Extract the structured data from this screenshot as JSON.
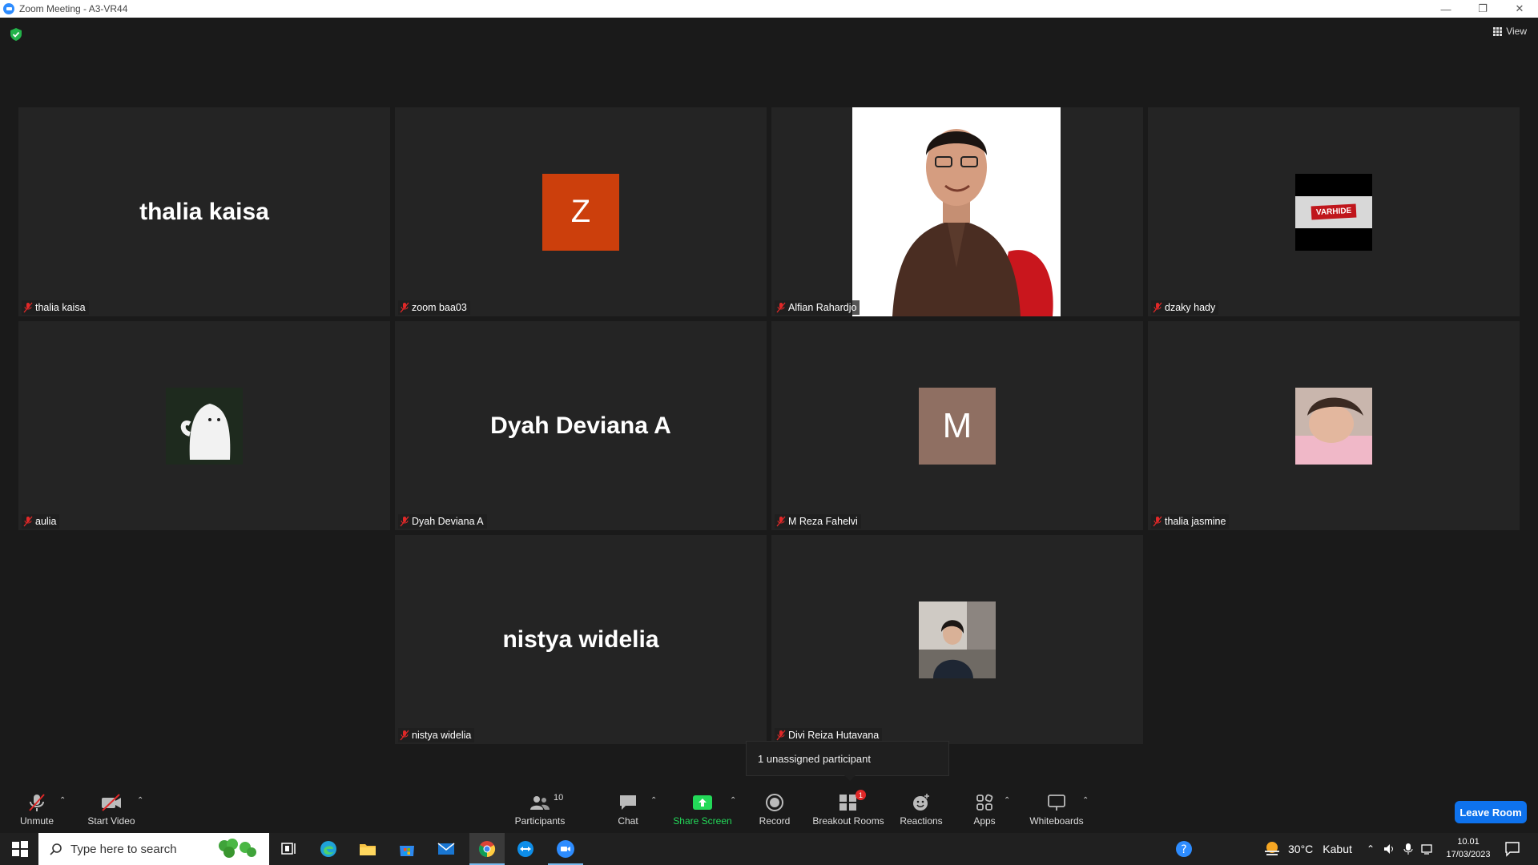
{
  "window": {
    "title": "Zoom Meeting - A3-VR44"
  },
  "view_button": {
    "label": "View"
  },
  "participants_tiles": [
    {
      "name": "thalia kaisa",
      "display": "thalia kaisa"
    },
    {
      "name": "zoom baa03",
      "initial": "Z",
      "color": "#cc3f0c"
    },
    {
      "name": "Alfian Rahardjo"
    },
    {
      "name": "dzaky hady"
    },
    {
      "name": "aulia"
    },
    {
      "name": "Dyah Deviana A",
      "display": "Dyah Deviana A"
    },
    {
      "name": "M Reza Fahelvi",
      "initial": "M",
      "color": "#8f6f62"
    },
    {
      "name": "thalia jasmine"
    },
    {
      "name": "nistya widelia",
      "display": "nistya widelia"
    },
    {
      "name": "Divi Reiza Hutavana"
    }
  ],
  "tooltip": {
    "text": "1 unassigned participant"
  },
  "logo_text": "VARHIDE",
  "toolbar": {
    "unmute": "Unmute",
    "start_video": "Start Video",
    "participants": "Participants",
    "participants_count": "10",
    "chat": "Chat",
    "share_screen": "Share Screen",
    "record": "Record",
    "breakout_rooms": "Breakout Rooms",
    "breakout_badge": "1",
    "reactions": "Reactions",
    "apps": "Apps",
    "whiteboards": "Whiteboards",
    "leave": "Leave Room"
  },
  "taskbar": {
    "search_placeholder": "Type here to search",
    "weather_temp": "30°C",
    "weather_desc": "Kabut",
    "time": "10.01",
    "date": "17/03/2023"
  },
  "colors": {
    "accent": "#0e72ed",
    "share": "#23d959",
    "mic_off": "#e02828"
  }
}
